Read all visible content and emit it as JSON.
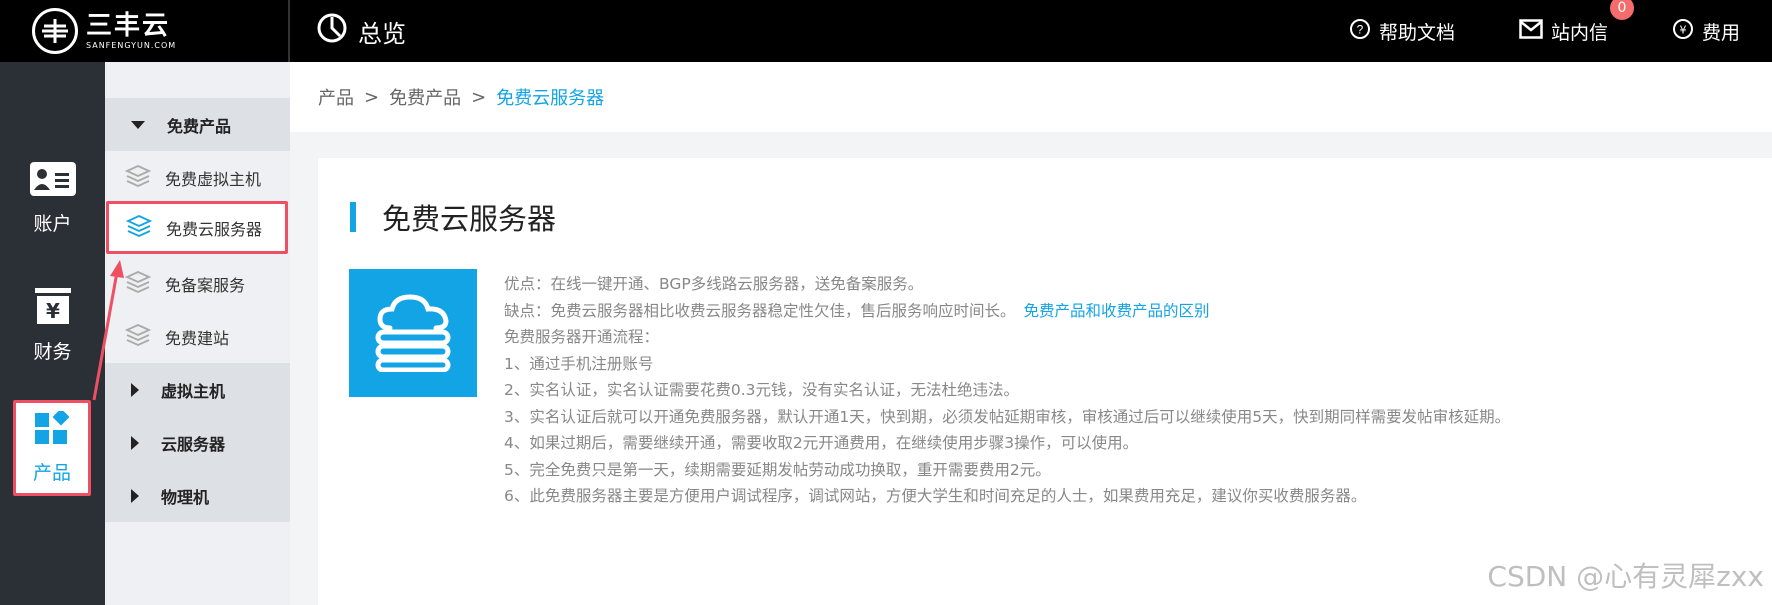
{
  "brand": {
    "logo_text": "三丰云",
    "logo_sub": "SANFENGYUN.COM"
  },
  "header": {
    "title": "总览",
    "help_label": "帮助文档",
    "messages_label": "站内信",
    "messages_count": "0",
    "fees_label": "费用"
  },
  "rail": {
    "items": [
      {
        "label": "账户",
        "icon": "account-card-icon"
      },
      {
        "label": "财务",
        "icon": "finance-yen-icon"
      },
      {
        "label": "产品",
        "icon": "product-blocks-icon"
      }
    ],
    "active": "产品"
  },
  "submenu": {
    "group_open": "免费产品",
    "items": [
      {
        "label": "免费虚拟主机",
        "icon": "layers-icon"
      },
      {
        "label": "免费云服务器",
        "icon": "layers-icon"
      },
      {
        "label": "免备案服务",
        "icon": "layers-icon"
      },
      {
        "label": "免费建站",
        "icon": "layers-icon"
      }
    ],
    "active": "免费云服务器",
    "groups": [
      "虚拟主机",
      "云服务器",
      "物理机"
    ]
  },
  "breadcrumb": {
    "items": [
      "产品",
      "免费产品",
      "免费云服务器"
    ],
    "separator": ">"
  },
  "content": {
    "title": "免费云服务器",
    "pros": "优点：在线一键开通、BGP多线路云服务器，送免备案服务。",
    "cons": "缺点：免费云服务器相比收费云服务器稳定性欠佳，售后服务响应时间长。",
    "cons_link": "免费产品和收费产品的区别",
    "process_title": "免费服务器开通流程：",
    "steps": [
      "1、通过手机注册账号",
      "2、实名认证，实名认证需要花费0.3元钱，没有实名认证，无法杜绝违法。",
      "3、实名认证后就可以开通免费服务器，默认开通1天，快到期，必须发帖延期审核，审核通过后可以继续使用5天，快到期同样需要发帖审核延期。",
      "4、如果过期后，需要继续开通，需要收取2元开通费用，在继续使用步骤3操作，可以使用。",
      "5、完全免费只是第一天，续期需要延期发帖劳动成功换取，重开需要费用2元。",
      "6、此免费服务器主要是方便用户调试程序，调试网站，方便大学生和时间充足的人士，如果费用充足，建议你买收费服务器。"
    ]
  },
  "watermark": "CSDN @心有灵犀zxx",
  "colors": {
    "accent": "#13a4e6",
    "highlight": "#ee4f62",
    "topbar": "#000000",
    "rail": "#2b2f36"
  }
}
